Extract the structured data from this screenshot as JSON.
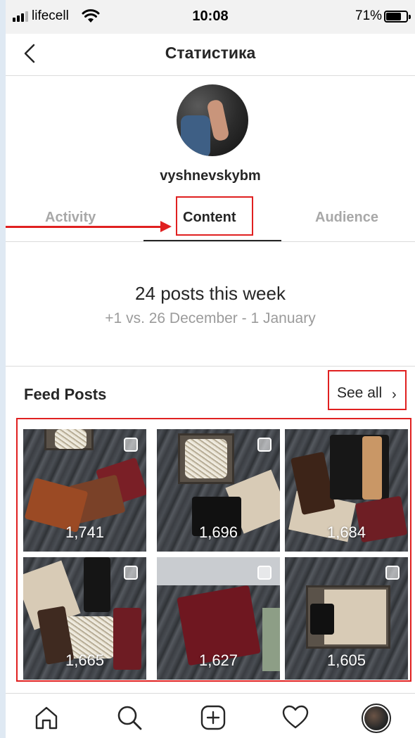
{
  "status_bar": {
    "carrier": "lifecell",
    "time": "10:08",
    "battery_percent": "71%",
    "signal_bars_filled": 3,
    "signal_bars_total": 4,
    "battery_level": 0.71
  },
  "header": {
    "title": "Статистика",
    "back_icon": "chevron-left-icon"
  },
  "profile": {
    "username": "vyshnevskybm"
  },
  "tabs": [
    {
      "label": "Activity",
      "active": false
    },
    {
      "label": "Content",
      "active": true
    },
    {
      "label": "Audience",
      "active": false
    }
  ],
  "summary": {
    "main": "24 posts this week",
    "sub": "+1 vs. 26 December - 1 January"
  },
  "feed_posts": {
    "title": "Feed Posts",
    "see_all_label": "See all",
    "see_all_icon": "chevron-right-icon",
    "posts": [
      {
        "count": "1,741"
      },
      {
        "count": "1,696"
      },
      {
        "count": "1,684"
      },
      {
        "count": "1,665"
      },
      {
        "count": "1,627"
      },
      {
        "count": "1,605"
      }
    ]
  },
  "bottom_nav": {
    "items": [
      "home-icon",
      "search-icon",
      "add-post-icon",
      "heart-icon",
      "profile-avatar"
    ]
  },
  "colors": {
    "accent_red": "#e02020",
    "text_primary": "#262626",
    "text_secondary": "#9b9b9b",
    "tab_inactive": "#a8a8a8",
    "divider": "#dbdbdb"
  }
}
